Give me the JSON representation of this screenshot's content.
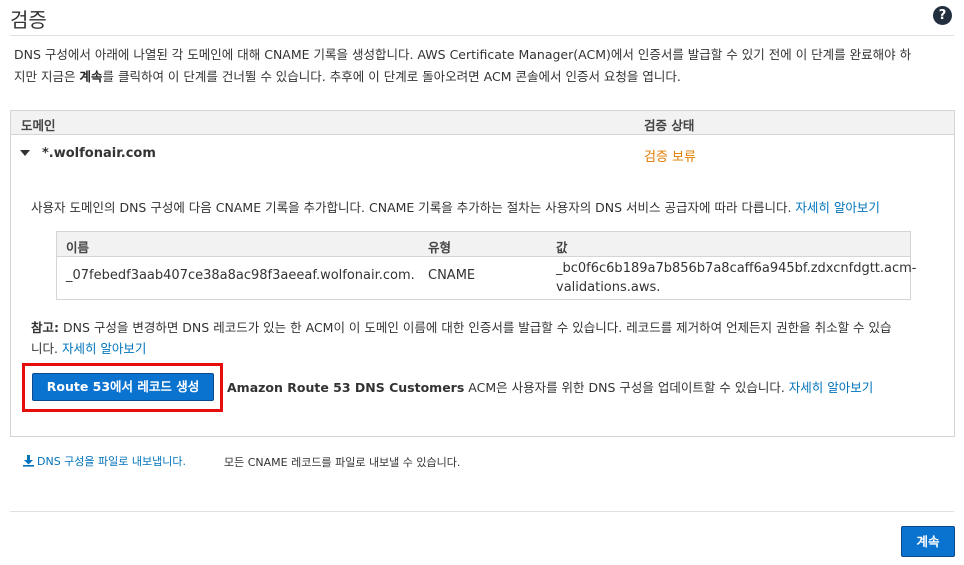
{
  "header": {
    "title": "검증",
    "help_icon": "question-circle-icon",
    "help_glyph": "?"
  },
  "intro": {
    "line1": "DNS 구성에서 아래에 나열된 각 도메인에 대해 CNAME 기록을 생성합니다. AWS Certificate Manager(ACM)에서 인증서를 발급할 수 있기 전에 이 단계를 완료해야 하",
    "line2_prefix": "지만 지금은 ",
    "line2_bold": "계속",
    "line2_suffix": "를 클릭하여 이 단계를 건너뛸 수 있습니다. 추후에 이 단계로 돌아오려면 ACM 콘솔에서 인증서 요청을 엽니다."
  },
  "table": {
    "col_domain": "도메인",
    "col_status": "검증 상태"
  },
  "domain": {
    "name": "*.wolfonair.com",
    "status": "검증 보류",
    "status_color": "#e07b00",
    "expand_icon": "caret-down-icon"
  },
  "instructions": {
    "text": "사용자 도메인의 DNS 구성에 다음 CNAME 기록을 추가합니다. CNAME 기록을 추가하는 절차는 사용자의 DNS 서비스 공급자에 따라 다릅니다. ",
    "link": "자세히 알아보기"
  },
  "record_table": {
    "col_name": "이름",
    "col_type": "유형",
    "col_value": "값",
    "name": "_07febedf3aab407ce38a8ac98f3aeeaf.wolfonair.com.",
    "type": "CNAME",
    "value_line1": "_bc0f6c6b189a7b856b7a8caff6a945bf.zdxcnfdgtt.acm-",
    "value_line2": "validations.aws."
  },
  "note": {
    "label": "참고:",
    "text": " DNS 구성을 변경하면 DNS 레코드가 있는 한 ACM이 이 도메인 이름에 대한 인증서를 발급할 수 있습니다. 레코드를 제거하여 언제든지 권한을 취소할 수 있습",
    "text2": "니다. ",
    "link": "자세히 알아보기"
  },
  "route53": {
    "button_label": "Route 53에서 레코드 생성",
    "desc_bold": "Amazon Route 53 DNS Customers",
    "desc": " ACM은 사용자를 위한 DNS 구성을 업데이트할 수 있습니다. ",
    "link": "자세히 알아보기",
    "highlight_color": "#e80d0d"
  },
  "export": {
    "link": "DNS 구성을 파일로 내보냅니다.",
    "icon": "download-icon",
    "desc": "모든 CNAME 레코드를 파일로 내보낼 수 있습니다."
  },
  "footer": {
    "continue_label": "계속"
  },
  "colors": {
    "primary_button": "#0a72cf",
    "link": "#0073bb"
  }
}
